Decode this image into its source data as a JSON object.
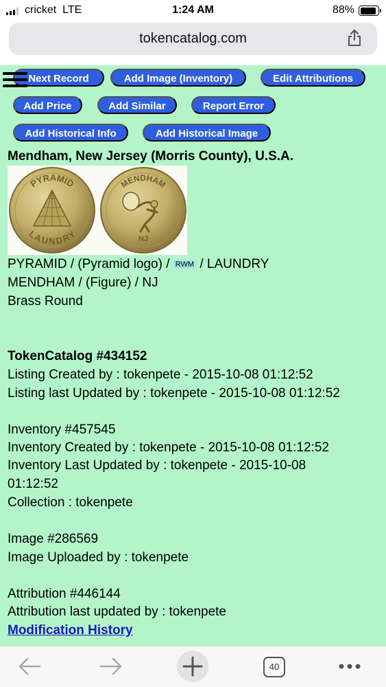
{
  "status_bar": {
    "carrier": "cricket",
    "network": "LTE",
    "time": "1:24 AM",
    "battery": "88%",
    "battery_level": 0.88
  },
  "browser": {
    "url": "tokencatalog.com",
    "tab_count": "40"
  },
  "buttons": {
    "next_record": "Next Record",
    "add_image_inventory": "Add Image (Inventory)",
    "edit_attributions": "Edit Attributions",
    "add_price": "Add Price",
    "add_similar": "Add Similar",
    "report_error": "Report Error",
    "add_historical_info": "Add Historical Info",
    "add_historical_image": "Add Historical Image"
  },
  "token": {
    "location": "Mendham, New Jersey (Morris County), U.S.A.",
    "obverse_text": "PYRAMID / (Pyramid logo) / ",
    "rwm": "RWM",
    "obverse_text_end": " / LAUNDRY",
    "reverse_text": "MENDHAM / (Figure) / NJ",
    "material_shape": "Brass Round",
    "coin_left_top": "PYRAMID",
    "coin_left_bottom": "LAUNDRY",
    "coin_right_top": "MENDHAM",
    "coin_right_bottom": "NJ"
  },
  "details": {
    "catalog_number": "TokenCatalog #434152",
    "listing_created": "Listing Created by : tokenpete - 2015-10-08 01:12:52",
    "listing_updated": "Listing last Updated by : tokenpete - 2015-10-08 01:12:52",
    "inventory_number": "Inventory #457545",
    "inventory_created": "Inventory Created by : tokenpete - 2015-10-08 01:12:52",
    "inventory_updated_line1": "Inventory Last Updated by : tokenpete - 2015-10-08",
    "inventory_updated_line2": "01:12:52",
    "collection": "Collection : tokenpete",
    "image_number": "Image #286569",
    "image_uploaded": "Image Uploaded by : tokenpete",
    "attribution_number": "Attribution #446144",
    "attribution_updated": "Attribution last updated by : tokenpete",
    "modification_history": "Modification History"
  },
  "colors": {
    "page_background": "#b3f5c9",
    "button": "#2f5fde",
    "link": "#1a1ab8"
  },
  "icons": {
    "back": "back-arrow-icon",
    "forward": "forward-arrow-icon",
    "new_tab": "plus-icon",
    "tabs": "tabs-icon",
    "more": "more-icon",
    "share": "share-icon",
    "menu": "hamburger-menu-icon"
  }
}
